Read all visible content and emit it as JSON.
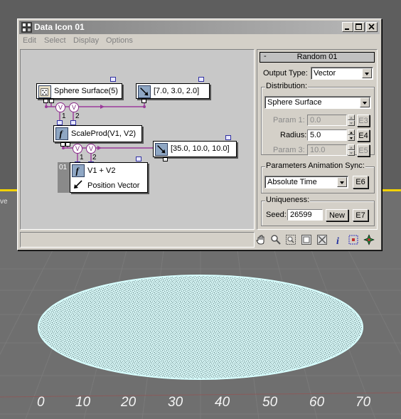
{
  "window": {
    "title": "Data Icon 01",
    "menu": [
      "Edit",
      "Select",
      "Display",
      "Options"
    ]
  },
  "viewport": {
    "label": "ve",
    "ruler_ticks": [
      "0",
      "10",
      "20",
      "30",
      "40",
      "50",
      "60",
      "70"
    ]
  },
  "schematic": {
    "nodes": {
      "sphere_surface": "Sphere Surface(5)",
      "vec1": "[7.0, 3.0, 2.0]",
      "scaleprod": "ScaleProd(V1, V2)",
      "vec2": "[35.0, 10.0, 10.0]",
      "add_line1": "V1 + V2",
      "add_line2": "Position Vector",
      "add_badge": "01"
    },
    "port_v": "V",
    "input_1": "1",
    "input_2": "2"
  },
  "panel": {
    "rollout_title": "Random 01",
    "rollout_toggle": "-",
    "output_type_label": "Output Type:",
    "output_type_value": "Vector",
    "distribution_group": "Distribution:",
    "distribution_value": "Sphere Surface",
    "param1_label": "Param 1:",
    "param1_value": "0.0",
    "param1_btn": "E3",
    "radius_label": "Radius:",
    "radius_value": "5.0",
    "radius_btn": "E4",
    "param3_label": "Param 3:",
    "param3_value": "10.0",
    "param3_btn": "E5",
    "sync_group": "Parameters Animation Sync:",
    "sync_value": "Absolute Time",
    "sync_btn": "E6",
    "uniqueness_group": "Uniqueness:",
    "seed_label": "Seed:",
    "seed_value": "26599",
    "new_btn": "New",
    "seed_btn": "E7"
  },
  "colors": {
    "particles": "#bff2f2",
    "wire": "#9a3a9a",
    "viewport_yellow": "#f2d200"
  }
}
